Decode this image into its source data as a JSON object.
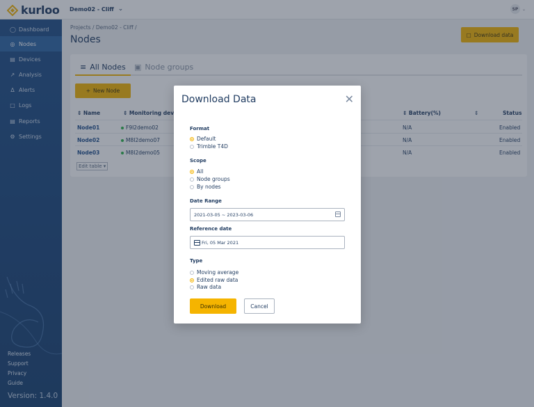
{
  "app": {
    "logo_text": "kurloo",
    "project": "Demo02 - Cliff",
    "user_initials": "SP"
  },
  "sidebar": {
    "items": [
      {
        "label": "Dashboard",
        "icon": "dashboard-icon"
      },
      {
        "label": "Nodes",
        "icon": "node-icon",
        "active": true
      },
      {
        "label": "Devices",
        "icon": "devices-icon"
      },
      {
        "label": "Analysis",
        "icon": "analysis-icon"
      },
      {
        "label": "Alerts",
        "icon": "bell-icon"
      },
      {
        "label": "Logs",
        "icon": "logs-icon"
      },
      {
        "label": "Reports",
        "icon": "reports-icon"
      },
      {
        "label": "Settings",
        "icon": "gear-icon"
      }
    ],
    "footer": [
      "Releases",
      "Support",
      "Privacy",
      "Guide"
    ],
    "version": "Version: 1.4.0"
  },
  "main": {
    "breadcrumb": "Projects / Demo02 - Cliff /",
    "title": "Nodes",
    "download_button": "Download data",
    "tabs": [
      {
        "label": "All Nodes"
      },
      {
        "label": "Node groups"
      }
    ],
    "new_node_button": "New Node",
    "table": {
      "headers": [
        "Name",
        "Monitoring device",
        "Battery(%)",
        "Status"
      ],
      "rows": [
        {
          "name": "Node01",
          "device": "F9I2demo02",
          "battery": "N/A",
          "status": "Enabled"
        },
        {
          "name": "Node02",
          "device": "M8I2demo07",
          "battery": "N/A",
          "status": "Enabled"
        },
        {
          "name": "Node03",
          "device": "M8I2demo05",
          "battery": "N/A",
          "status": "Enabled"
        }
      ]
    },
    "edit_table": "Edit table"
  },
  "modal": {
    "title": "Download Data",
    "format": {
      "label": "Format",
      "options": [
        "Default",
        "Trimble T4D"
      ],
      "selected": "Default"
    },
    "scope": {
      "label": "Scope",
      "options": [
        "All",
        "Node groups",
        "By nodes"
      ],
      "selected": "All"
    },
    "date_range": {
      "label": "Date Range",
      "value": "2021-03-05 ~ 2023-03-06"
    },
    "reference_date": {
      "label": "Reference date",
      "value": "Fri, 05 Mar 2021"
    },
    "type": {
      "label": "Type",
      "options": [
        "Moving average",
        "Edited raw data",
        "Raw data"
      ],
      "selected": "Edited raw data"
    },
    "download_label": "Download",
    "cancel_label": "Cancel"
  },
  "colors": {
    "accent": "#f5b400",
    "sidebar": "#1f4e86",
    "text": "#1e3a5f"
  }
}
